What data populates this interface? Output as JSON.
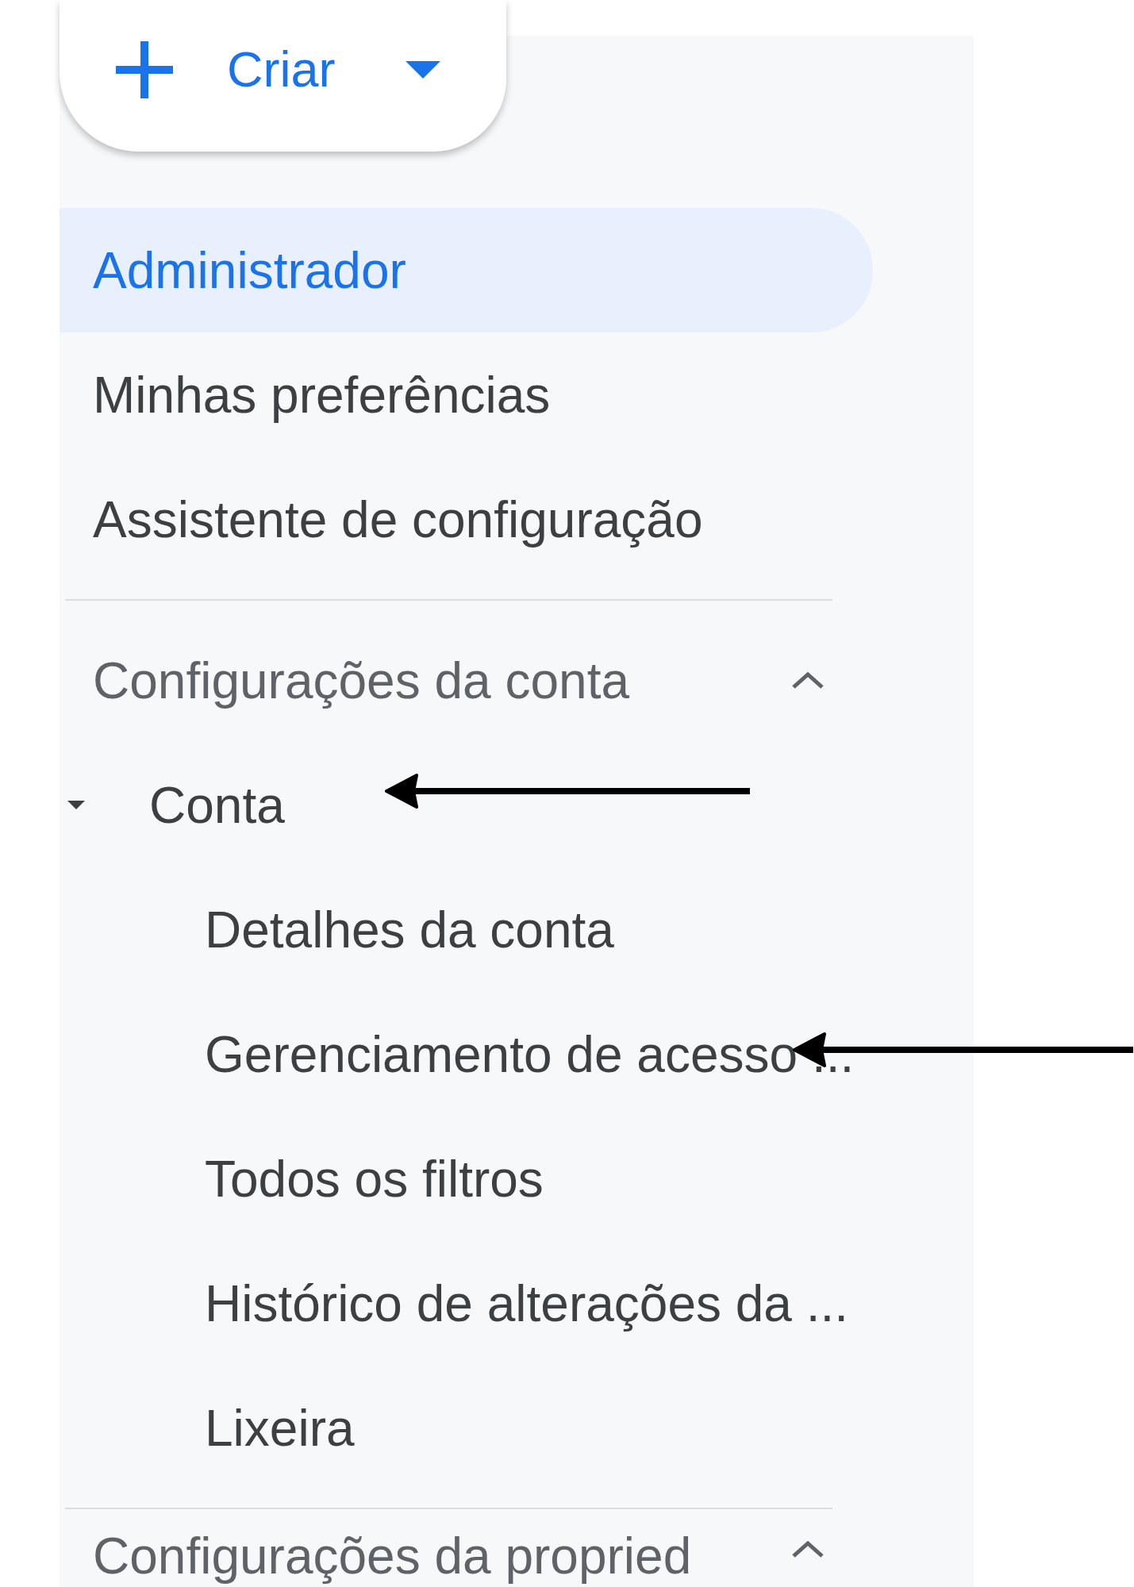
{
  "create_button": {
    "label": "Criar"
  },
  "nav": [
    {
      "label": "Administrador",
      "selected": true
    },
    {
      "label": "Minhas preferências",
      "selected": false
    },
    {
      "label": "Assistente de configuração",
      "selected": false
    }
  ],
  "sections": [
    {
      "title": "Configurações da conta",
      "expanded": true,
      "groups": [
        {
          "label": "Conta",
          "expanded": true,
          "selected": false,
          "pointed_at": true,
          "children": [
            {
              "label": "Detalhes da conta",
              "selected": false,
              "pointed_at": false
            },
            {
              "label": "Gerenciamento de acesso ...",
              "selected": false,
              "pointed_at": true
            },
            {
              "label": "Todos os filtros",
              "selected": false,
              "pointed_at": false
            },
            {
              "label": "Histórico de alterações da ...",
              "selected": false,
              "pointed_at": false
            },
            {
              "label": "Lixeira",
              "selected": false,
              "pointed_at": false
            }
          ]
        }
      ]
    },
    {
      "title": "Configurações da propried",
      "expanded": true
    }
  ]
}
